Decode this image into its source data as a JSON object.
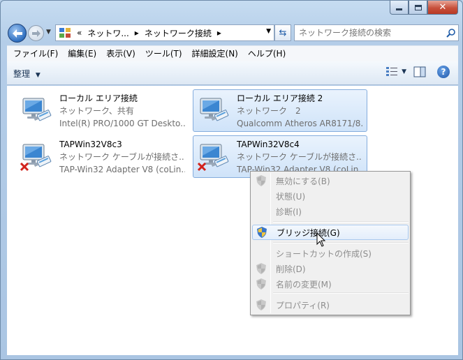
{
  "window": {
    "caption_buttons": {
      "minimize_icon": "minimize-icon",
      "maximize_icon": "maximize-icon",
      "close_icon": "close-icon"
    }
  },
  "navigation": {
    "back_icon": "back-arrow-icon",
    "forward_icon": "forward-arrow-icon",
    "overflow": "«",
    "breadcrumbs": [
      "ネットワ...",
      "ネットワーク接続"
    ],
    "refresh_icon": "refresh-icon",
    "search_placeholder": "ネットワーク接続の検索"
  },
  "menubar": {
    "items": [
      "ファイル(F)",
      "編集(E)",
      "表示(V)",
      "ツール(T)",
      "詳細設定(N)",
      "ヘルプ(H)"
    ]
  },
  "toolbar": {
    "organize_label": "整理",
    "help_label": "?"
  },
  "connections": [
    {
      "name": "ローカル エリア接続",
      "status": "ネットワーク、共有",
      "adapter": "Intel(R) PRO/1000 GT Deskto...",
      "selected": false,
      "disconnected": false
    },
    {
      "name": "ローカル エリア接続 2",
      "status": "ネットワーク　2",
      "adapter": "Qualcomm Atheros AR8171/8...",
      "selected": true,
      "disconnected": false
    },
    {
      "name": "TAPWin32V8c3",
      "status": "ネットワーク ケーブルが接続さ...",
      "adapter": "TAP-Win32 Adapter V8 (coLin...",
      "selected": false,
      "disconnected": true
    },
    {
      "name": "TAPWin32V8c4",
      "status": "ネットワーク ケーブルが接続さ...",
      "adapter": "TAP-Win32 Adapter V8 (coLin...",
      "selected": true,
      "disconnected": true
    }
  ],
  "context_menu": {
    "items": [
      {
        "label": "無効にする(B)",
        "shield": true,
        "disabled": true
      },
      {
        "label": "状態(U)",
        "shield": false,
        "disabled": true
      },
      {
        "label": "診断(I)",
        "shield": false,
        "disabled": true
      },
      {
        "label": "ブリッジ接続(G)",
        "shield": true,
        "disabled": false,
        "hover": true
      },
      {
        "label": "ショートカットの作成(S)",
        "shield": false,
        "disabled": true
      },
      {
        "label": "削除(D)",
        "shield": true,
        "disabled": true
      },
      {
        "label": "名前の変更(M)",
        "shield": true,
        "disabled": true
      },
      {
        "label": "プロパティ(R)",
        "shield": true,
        "disabled": true
      }
    ]
  }
}
